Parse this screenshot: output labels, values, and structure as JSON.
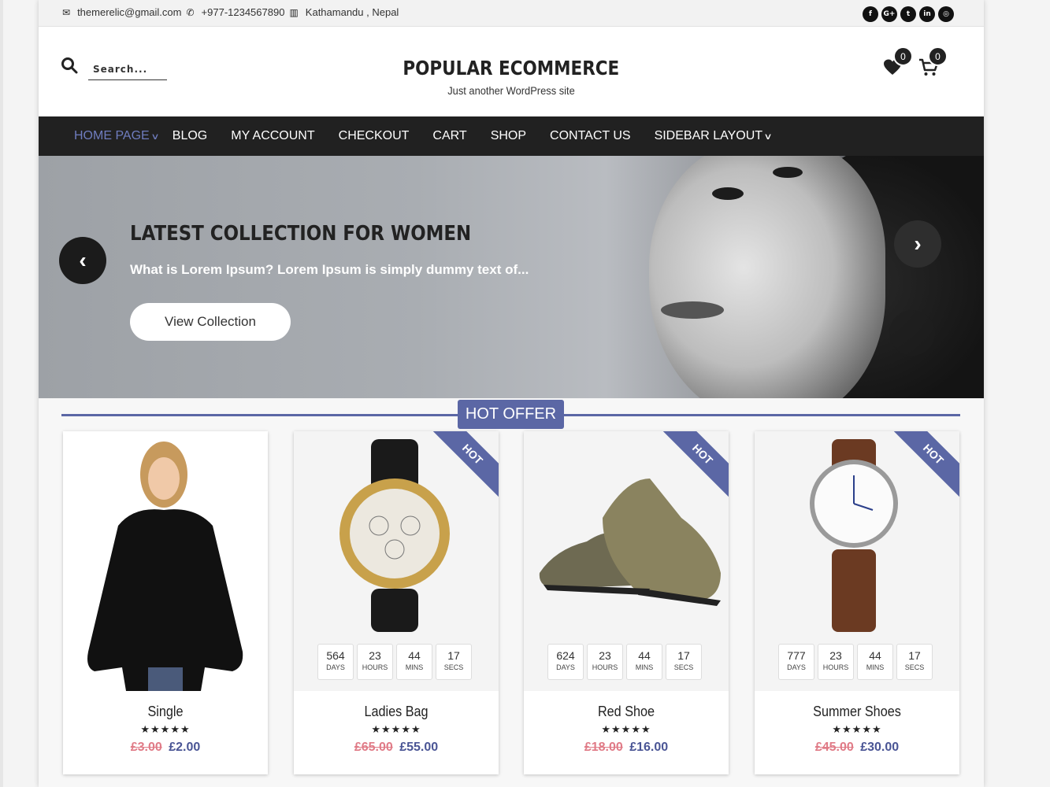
{
  "topbar": {
    "email": "themerelic@gmail.com",
    "phone": "+977-1234567890",
    "location": "Kathamandu , Nepal",
    "social": [
      {
        "icon": "facebook-icon",
        "glyph": "f"
      },
      {
        "icon": "google-plus-icon",
        "glyph": "G+"
      },
      {
        "icon": "twitter-icon",
        "glyph": "t"
      },
      {
        "icon": "linkedin-icon",
        "glyph": "in"
      },
      {
        "icon": "instagram-icon",
        "glyph": "◎"
      }
    ]
  },
  "header": {
    "search_placeholder": "Search...",
    "site_title": "POPULAR ECOMMERCE",
    "tagline": "Just another WordPress site",
    "wishlist_count": "0",
    "cart_count": "0"
  },
  "nav": {
    "items": [
      {
        "label": "HOME PAGE",
        "dropdown": true,
        "active": true
      },
      {
        "label": "BLOG"
      },
      {
        "label": "MY ACCOUNT"
      },
      {
        "label": "CHECKOUT"
      },
      {
        "label": "CART"
      },
      {
        "label": "SHOP"
      },
      {
        "label": "CONTACT US"
      },
      {
        "label": "SIDEBAR LAYOUT",
        "dropdown": true
      }
    ]
  },
  "hero": {
    "title": "LATEST COLLECTION FOR WOMEN",
    "subtitle": "What is Lorem Ipsum? Lorem Ipsum is simply dummy text of...",
    "button": "View Collection"
  },
  "section": {
    "title": "HOT OFFER"
  },
  "products": [
    {
      "name": "Single",
      "old_price": "£3.00",
      "new_price": "£2.00",
      "hot": false,
      "timer": null
    },
    {
      "name": "Ladies Bag",
      "old_price": "£65.00",
      "new_price": "£55.00",
      "hot": true,
      "ribbon": "HOT",
      "timer": [
        {
          "num": "564",
          "lbl": "DAYS"
        },
        {
          "num": "23",
          "lbl": "HOURS"
        },
        {
          "num": "44",
          "lbl": "MINS"
        },
        {
          "num": "17",
          "lbl": "SECS"
        }
      ]
    },
    {
      "name": "Red Shoe",
      "old_price": "£18.00",
      "new_price": "£16.00",
      "hot": true,
      "ribbon": "HOT",
      "timer": [
        {
          "num": "624",
          "lbl": "DAYS"
        },
        {
          "num": "23",
          "lbl": "HOURS"
        },
        {
          "num": "44",
          "lbl": "MINS"
        },
        {
          "num": "17",
          "lbl": "SECS"
        }
      ]
    },
    {
      "name": "Summer Shoes",
      "old_price": "£45.00",
      "new_price": "£30.00",
      "hot": true,
      "ribbon": "HOT",
      "timer": [
        {
          "num": "777",
          "lbl": "DAYS"
        },
        {
          "num": "23",
          "lbl": "HOURS"
        },
        {
          "num": "44",
          "lbl": "MINS"
        },
        {
          "num": "17",
          "lbl": "SECS"
        }
      ]
    }
  ],
  "rating_stars": "★★★★★",
  "colors": {
    "accent": "#5b67a5",
    "nav_bg": "#212121",
    "old_price": "#e07b87",
    "new_price": "#4a5595"
  }
}
